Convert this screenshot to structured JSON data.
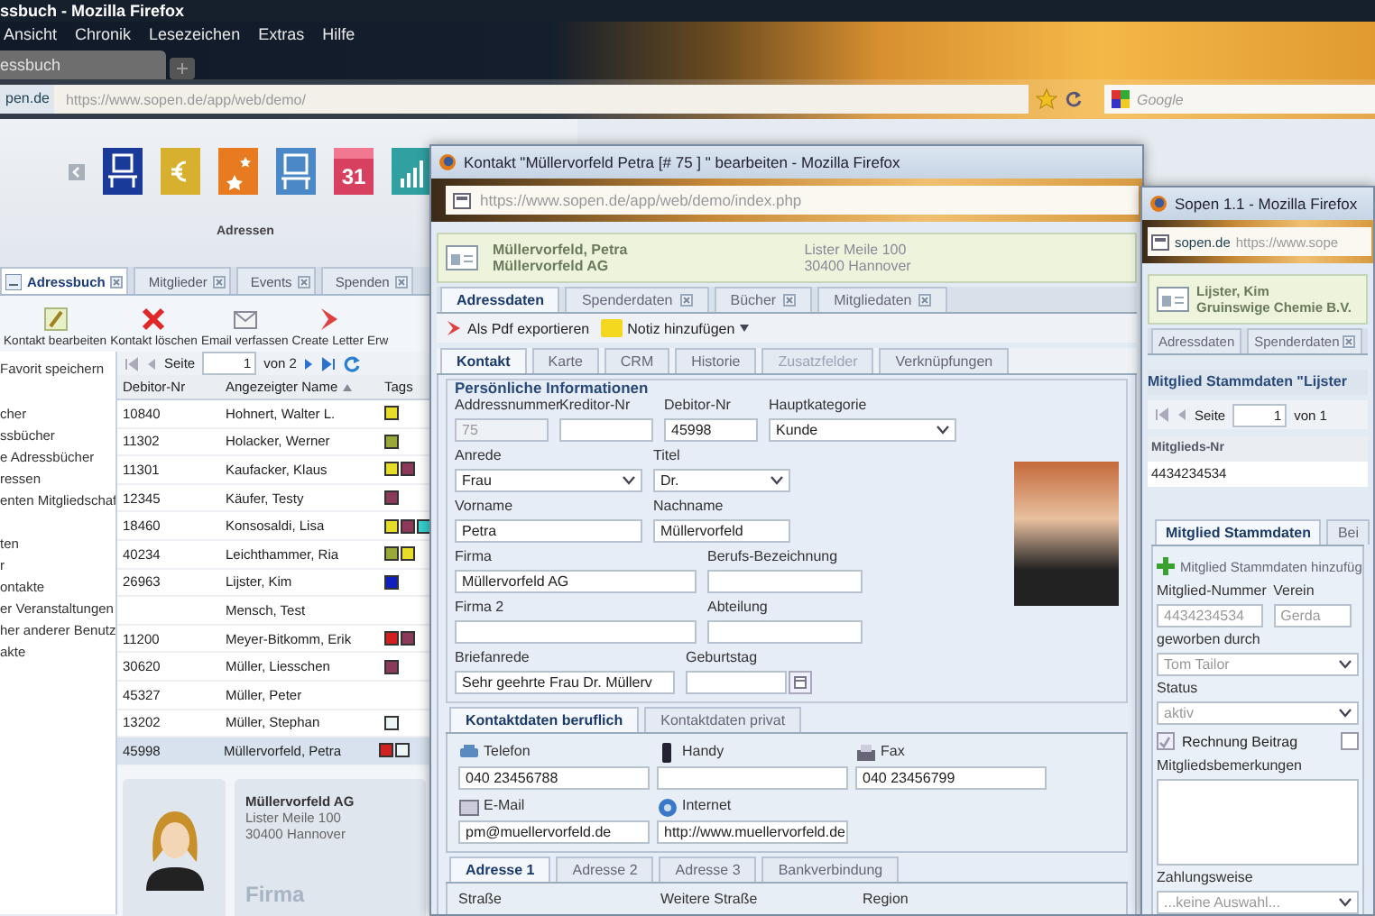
{
  "browser": {
    "title": "ssbuch - Mozilla Firefox",
    "menu": [
      "Ansicht",
      "Chronik",
      "Lesezeichen",
      "Extras",
      "Hilfe"
    ],
    "tab": "essbuch",
    "site": "pen.de",
    "url": "https://www.sopen.de/app/web/demo/",
    "search_placeholder": "Google"
  },
  "app": {
    "modules": [
      {
        "kind": "address"
      },
      {
        "kind": "euro"
      },
      {
        "kind": "stars"
      },
      {
        "kind": "monitor"
      },
      {
        "kind": "calendar",
        "text": "31"
      },
      {
        "kind": "chart"
      }
    ],
    "modules_label": "Adressen",
    "tabs": [
      {
        "label": "Adressbuch",
        "selected": true
      },
      {
        "label": "Mitglieder",
        "selected": false
      },
      {
        "label": "Events",
        "selected": false
      },
      {
        "label": "Spenden",
        "selected": false
      }
    ],
    "toolbar": [
      {
        "kind": "edit",
        "label": "Kontakt bearbeiten"
      },
      {
        "kind": "delete",
        "label": "Kontakt löschen"
      },
      {
        "kind": "email",
        "label": "Email verfassen"
      },
      {
        "kind": "letter",
        "label": "Create Letter"
      },
      {
        "kind": "more",
        "label": "Erw"
      }
    ],
    "favorite": "Favorit speichern",
    "tree": [
      {
        "items": [
          "cher",
          "ssbücher",
          "e Adressbücher",
          "ressen",
          "enten Mitgliedschaf"
        ]
      },
      {
        "items": [
          "ten",
          "r",
          "ontakte",
          "er Veranstaltungen",
          "her anderer Benutz",
          "akte"
        ]
      }
    ],
    "pager": {
      "label": "Seite",
      "page": "1",
      "of": "von 2"
    },
    "columns": [
      "Debitor-Nr",
      "Angezeigter Name",
      "Tags"
    ],
    "rows": [
      {
        "debitor": "10840",
        "name": "Hohnert, Walter L.",
        "selected": false,
        "tags": [
          {
            "color": "#e6dc2a"
          }
        ]
      },
      {
        "debitor": "11302",
        "name": "Holacker, Werner",
        "selected": false,
        "tags": [
          {
            "color": "#9aa83a"
          }
        ]
      },
      {
        "debitor": "11301",
        "name": "Kaufacker, Klaus",
        "selected": false,
        "tags": [
          {
            "color": "#e6dc2a"
          },
          {
            "color": "#8c3a5a"
          }
        ]
      },
      {
        "debitor": "12345",
        "name": "Käufer, Testy",
        "selected": false,
        "tags": [
          {
            "color": "#8c3a5a"
          }
        ]
      },
      {
        "debitor": "18460",
        "name": "Konsosaldi, Lisa",
        "selected": false,
        "tags": [
          {
            "color": "#e6dc2a"
          },
          {
            "color": "#8c3a5a"
          },
          {
            "color": "#38d0d0"
          }
        ]
      },
      {
        "debitor": "40234",
        "name": "Leichthammer, Ria",
        "selected": false,
        "tags": [
          {
            "color": "#9aa83a"
          },
          {
            "color": "#e6dc2a"
          }
        ]
      },
      {
        "debitor": "26963",
        "name": "Lijster, Kim",
        "selected": false,
        "tags": [
          {
            "color": "#1020c0"
          }
        ]
      },
      {
        "name": "Mensch, Test",
        "selected": false,
        "tags": []
      },
      {
        "debitor": "11200",
        "name": "Meyer-Bitkomm, Erik",
        "selected": false,
        "tags": [
          {
            "color": "#d02020"
          },
          {
            "color": "#8c3a5a"
          }
        ]
      },
      {
        "debitor": "30620",
        "name": "Müller, Liesschen",
        "selected": false,
        "tags": [
          {
            "color": "#8c3a5a"
          }
        ]
      },
      {
        "debitor": "45327",
        "name": "Müller, Peter",
        "selected": false,
        "tags": []
      },
      {
        "debitor": "13202",
        "name": "Müller, Stephan",
        "selected": false,
        "tags": [
          {
            "color": "#eaf6f6"
          }
        ]
      },
      {
        "debitor": "45998",
        "name": "Müllervorfeld, Petra",
        "selected": true,
        "tags": [
          {
            "color": "#d02020"
          },
          {
            "color": "#eaf6f6"
          }
        ]
      }
    ],
    "card": {
      "company": "Müllervorfeld AG",
      "street": "Lister Meile 100",
      "city": "30400 Hannover",
      "caption": "Firma"
    }
  },
  "contact_window": {
    "title": "Kontakt \"Müllervorfeld Petra [# 75 ] \" bearbeiten - Mozilla Firefox",
    "url": "https://www.sopen.de/app/web/demo/index.php",
    "header": {
      "name": "Müllervorfeld, Petra",
      "company": "Müllervorfeld AG",
      "street": "Lister Meile 100",
      "city": "30400 Hannover"
    },
    "tabs": [
      {
        "label": "Adressdaten",
        "selected": true,
        "closable": false
      },
      {
        "label": "Spenderdaten",
        "selected": false,
        "closable": true
      },
      {
        "label": "Bücher",
        "selected": false,
        "closable": true
      },
      {
        "label": "Mitgliedaten",
        "selected": false,
        "closable": true
      }
    ],
    "actions": [
      {
        "kind": "pdf",
        "label": "Als Pdf exportieren"
      },
      {
        "kind": "note",
        "label": "Notiz hinzufügen"
      }
    ],
    "subtabs": [
      {
        "label": "Kontakt",
        "selected": true,
        "disabled": false
      },
      {
        "label": "Karte",
        "selected": false,
        "disabled": false
      },
      {
        "label": "CRM",
        "selected": false,
        "disabled": false
      },
      {
        "label": "Historie",
        "selected": false,
        "disabled": false
      },
      {
        "label": "Zusatzfelder",
        "selected": false,
        "disabled": true
      },
      {
        "label": "Verknüpfungen",
        "selected": false,
        "disabled": false
      }
    ],
    "personal": {
      "legend": "Persönliche Informationen",
      "rows": [
        [
          {
            "label": "Addressnummer",
            "kind": "text",
            "value": "75",
            "disabled": true
          },
          {
            "label": "Kreditor-Nr",
            "kind": "text",
            "disabled": false
          },
          {
            "label": "Debitor-Nr",
            "kind": "text",
            "value": "45998",
            "disabled": false
          },
          {
            "label": "Hauptkategorie",
            "kind": "select",
            "value": "Kunde",
            "disabled": false
          }
        ],
        [
          {
            "label": "Anrede",
            "kind": "select",
            "value": "Frau",
            "disabled": false
          },
          {
            "label": "Titel",
            "kind": "select",
            "value": "Dr.",
            "disabled": false
          }
        ],
        [
          {
            "label": "Vorname",
            "kind": "text",
            "value": "Petra",
            "disabled": false
          },
          {
            "label": "Nachname",
            "kind": "text",
            "value": "Müllervorfeld",
            "disabled": false
          }
        ],
        [
          {
            "label": "Firma",
            "kind": "text",
            "value": "Müllervorfeld AG",
            "disabled": false
          },
          {
            "label": "Berufs-Bezeichnung",
            "kind": "text",
            "disabled": false
          }
        ],
        [
          {
            "label": "Firma 2",
            "kind": "text",
            "disabled": false
          },
          {
            "label": "Abteilung",
            "kind": "text",
            "disabled": false
          }
        ],
        [
          {
            "label": "Briefanrede",
            "kind": "text",
            "value": "Sehr geehrte Frau Dr. Müllerv",
            "disabled": false
          },
          {
            "label": "Geburtstag",
            "kind": "date",
            "disabled": false
          }
        ]
      ]
    },
    "contact_tabs": [
      {
        "label": "Kontaktdaten beruflich",
        "selected": true
      },
      {
        "label": "Kontaktdaten privat",
        "selected": false
      }
    ],
    "contact_rows": [
      [
        {
          "kind": "phone",
          "label": "Telefon",
          "value": "040 23456788"
        },
        {
          "kind": "mobile",
          "label": "Handy"
        },
        {
          "kind": "fax",
          "label": "Fax",
          "value": "040 23456799"
        }
      ],
      [
        {
          "kind": "email",
          "label": "E-Mail",
          "value": "pm@muellervorfeld.de"
        },
        {
          "kind": "web",
          "label": "Internet",
          "value": "http://www.muellervorfeld.de"
        }
      ]
    ],
    "address_tabs": [
      {
        "label": "Adresse 1",
        "selected": true
      },
      {
        "label": "Adresse 2",
        "selected": false
      },
      {
        "label": "Adresse 3",
        "selected": false
      },
      {
        "label": "Bankverbindung",
        "selected": false
      }
    ],
    "address_fields": [
      "Straße",
      "Weitere Straße",
      "Region"
    ]
  },
  "member_window": {
    "title": "Sopen 1.1 - Mozilla Firefox",
    "site": "sopen.de",
    "url": "https://www.sope",
    "header": {
      "name": "Lijster, Kim",
      "company": "Gruinswige Chemie B.V."
    },
    "tabs": [
      {
        "label": "Adressdaten",
        "selected": false,
        "closable": false
      },
      {
        "label": "Spenderdaten",
        "selected": false,
        "closable": true
      }
    ],
    "panel_title": "Mitglied Stammdaten \"Lijster",
    "pager": {
      "label": "Seite",
      "page": "1",
      "of": "von 1"
    },
    "column": "Mitglieds-Nr",
    "rows": [
      "4434234534"
    ],
    "subtabs": [
      {
        "label": "Mitglied Stammdaten",
        "selected": true
      },
      {
        "label": "Bei",
        "selected": false
      }
    ],
    "add_button": "Mitglied Stammdaten hinzufüg",
    "fields": [
      {
        "label": "Mitglied-Nummer",
        "kind": "text",
        "value": "4434234534"
      },
      {
        "label": "Verein",
        "kind": "text",
        "value": "Gerda"
      },
      {
        "label": "geworben durch",
        "kind": "select",
        "value": "Tom Tailor"
      },
      {
        "label": "Status",
        "kind": "select",
        "value": "aktiv"
      }
    ],
    "checkboxes": [
      {
        "label": "Rechnung Beitrag",
        "checked": true
      },
      {
        "checked": false
      }
    ],
    "notes_label": "Mitgliedsbemerkungen",
    "payment": {
      "label": "Zahlungsweise",
      "value": "...keine Auswahl..."
    }
  }
}
